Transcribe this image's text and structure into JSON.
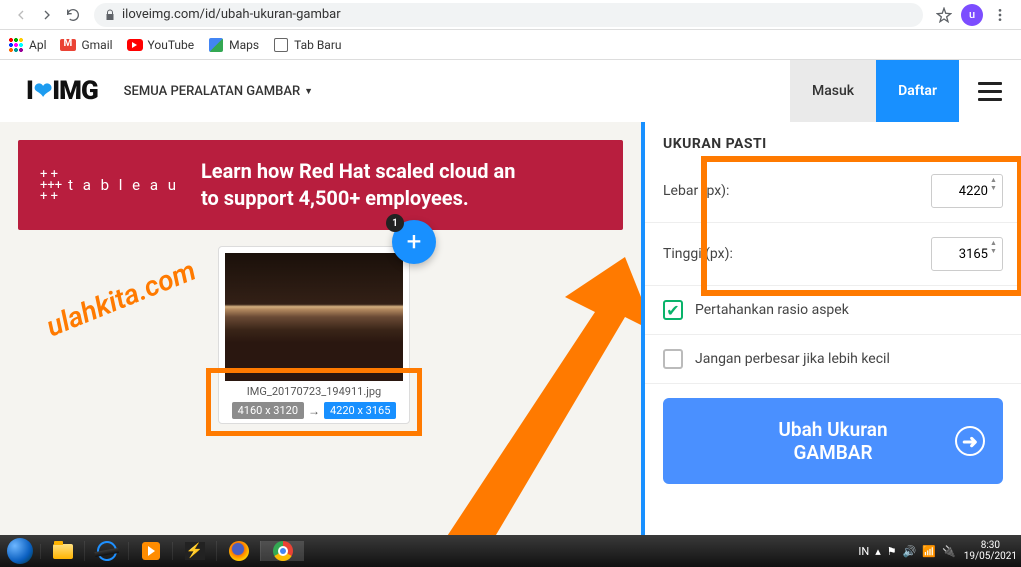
{
  "browser": {
    "url": "iloveimg.com/id/ubah-ukuran-gambar",
    "avatar_letter": "u"
  },
  "bookmarks": {
    "apps": "Apl",
    "gmail": "Gmail",
    "youtube": "YouTube",
    "maps": "Maps",
    "newtab": "Tab Baru"
  },
  "header": {
    "logo_pre": "I",
    "logo_post": "IMG",
    "tools": "SEMUA PERALATAN GAMBAR",
    "login": "Masuk",
    "signup": "Daftar"
  },
  "ad": {
    "brand": "t a b l e a u",
    "line": "Learn how Red Hat scaled cloud an\nto support 4,500+ employees."
  },
  "file": {
    "name": "IMG_20170723_194911.jpg",
    "size_original": "4160 x 3120",
    "size_new": "4220 x 3165",
    "added_count": "1"
  },
  "watermark": "ulahkita.com",
  "panel": {
    "title": "UKURAN PASTI",
    "width_label": "Lebar (px):",
    "width_value": "4220",
    "height_label": "Tinggi (px):",
    "height_value": "3165",
    "keep_ratio": "Pertahankan rasio aspek",
    "no_enlarge": "Jangan perbesar jika lebih kecil",
    "cta_line1": "Ubah Ukuran",
    "cta_line2": "GAMBAR"
  },
  "taskbar": {
    "lang": "IN",
    "time": "8:30",
    "date": "19/05/2021"
  }
}
